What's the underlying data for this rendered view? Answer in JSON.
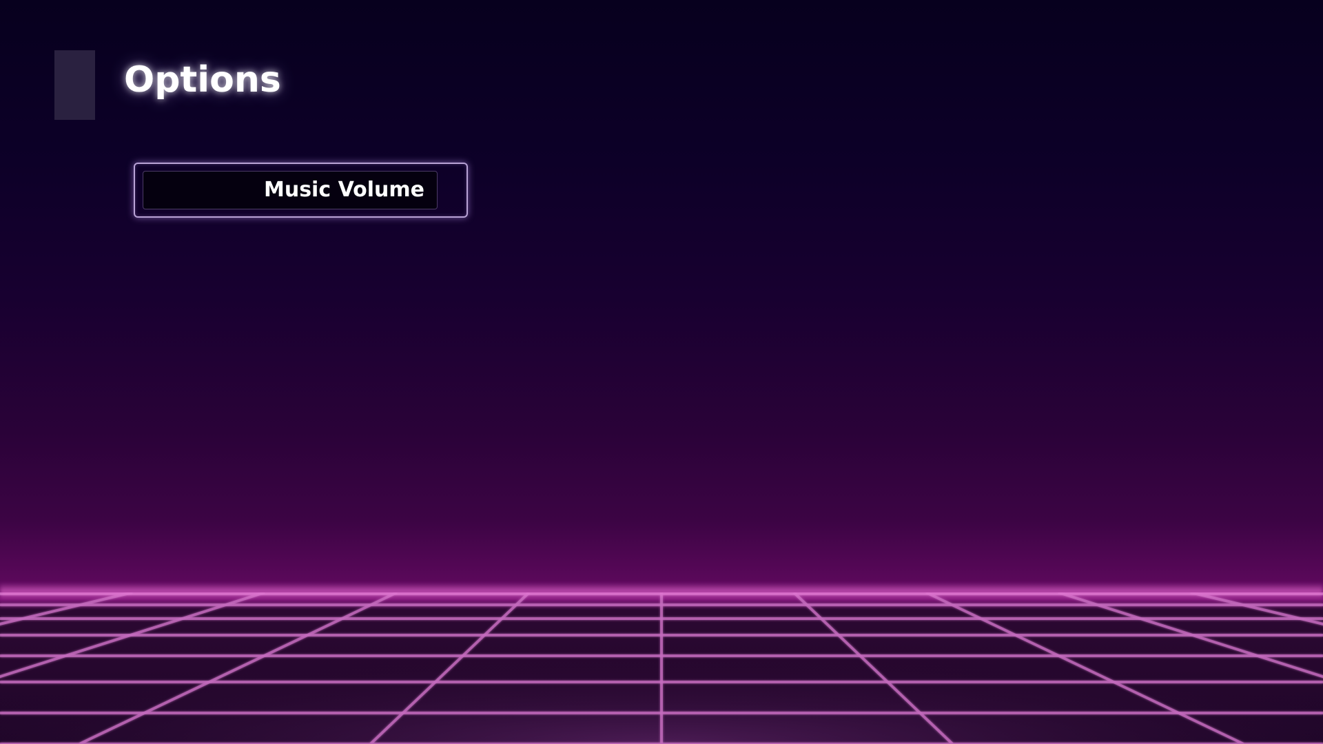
{
  "screen": {
    "title": "Options",
    "back_icon": "back-tab"
  },
  "options": [
    {
      "label": "Music Volume",
      "selected": true
    }
  ],
  "colors": {
    "background_top": "#07001e",
    "background_mid": "#2a0238",
    "horizon": "#7e1277",
    "grid_line": "#c46bbd",
    "accent_border": "#b9a3d6"
  }
}
